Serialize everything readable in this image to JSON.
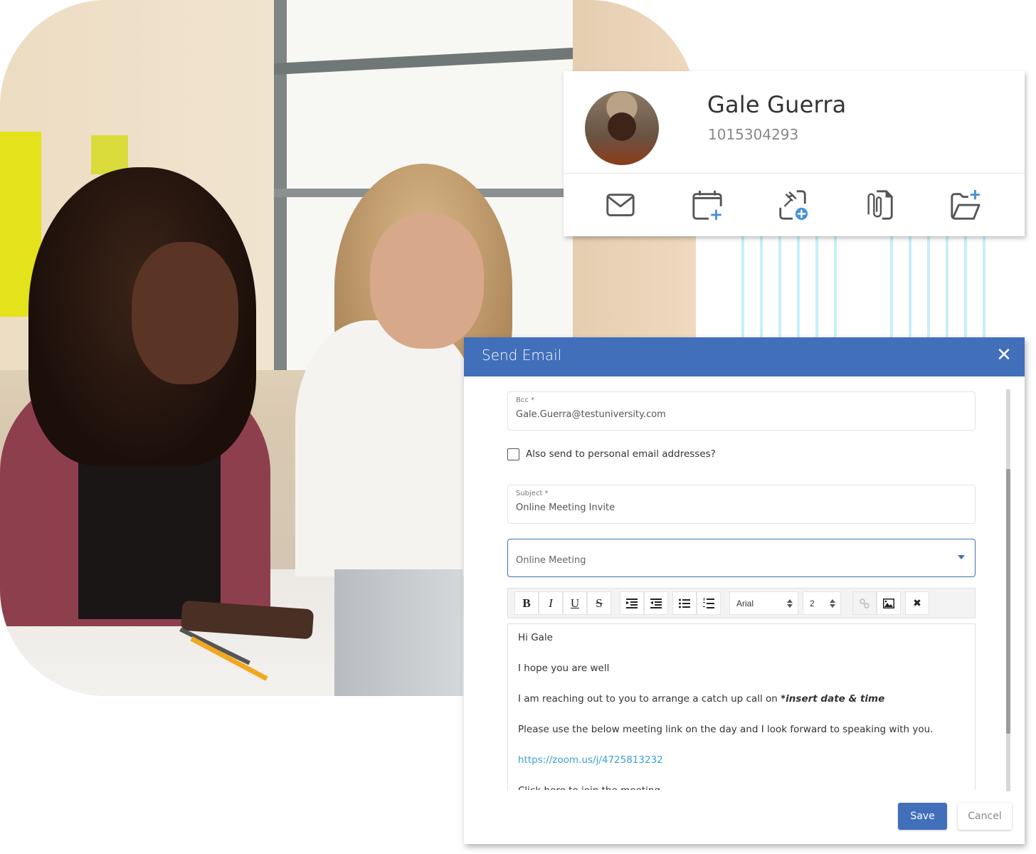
{
  "background_photo": {
    "description": "Two women looking at a laptop in a bright office"
  },
  "contact": {
    "name": "Gale Guerra",
    "id": "1015304293",
    "actions": [
      {
        "icon": "envelope-icon",
        "label": "Send email"
      },
      {
        "icon": "calendar-add-icon",
        "label": "Add appointment"
      },
      {
        "icon": "pin-add-icon",
        "label": "Add pin"
      },
      {
        "icon": "attach-document-icon",
        "label": "Attach document"
      },
      {
        "icon": "folder-add-icon",
        "label": "Add folder"
      }
    ]
  },
  "modal": {
    "title": "Send Email",
    "close_glyph": "✕",
    "bcc": {
      "label": "Bcc *",
      "value": "Gale.Guerra@testuniversity.com"
    },
    "personal_email_checkbox": {
      "label": "Also send to personal email addresses?",
      "checked": false
    },
    "subject": {
      "label": "Subject *",
      "value": "Online Meeting Invite"
    },
    "template_select": {
      "value": "Online Meeting"
    },
    "toolbar": {
      "bold": "B",
      "italic": "I",
      "underline": "U",
      "strikethrough": "S",
      "font_family": "Arial",
      "font_size": "2",
      "remove_format": "✖"
    },
    "body": {
      "greeting": "Hi Gale",
      "line2": "I hope you are well",
      "line3_prefix": "I am reaching out to you to arrange a catch up call on ",
      "line3_placeholder": "*insert date & time",
      "line4": "Please use the below meeting link on the day and I look forward to speaking with you.",
      "link": "https://zoom.us/j/4725813232",
      "line6": "Click here to join the meeting"
    },
    "save_label": "Save",
    "cancel_label": "Cancel"
  },
  "colors": {
    "accent": "#416fba",
    "link": "#3aa0d8",
    "icon_plus": "#4a90d9",
    "stripes": "#c6f0fb"
  }
}
